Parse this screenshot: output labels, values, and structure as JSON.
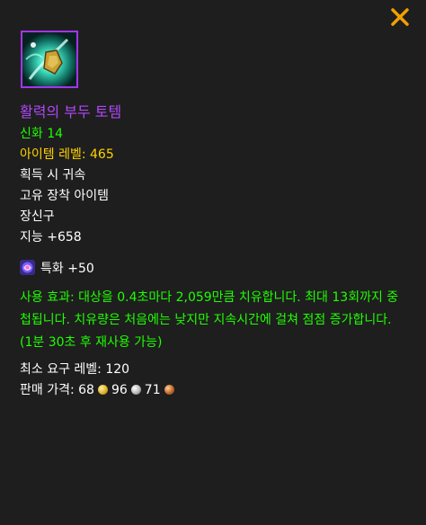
{
  "tooltip": {
    "close_icon": "close-x-icon",
    "item_icon": "totem-icon",
    "name": "활력의 부두 토템",
    "difficulty": "신화 14",
    "item_level": "아이템 레벨: 465",
    "binding": "획득 시 귀속",
    "unique": "고유 장착 아이템",
    "slot": "장신구",
    "primary_stat": "지능 +658",
    "secondary_stat_icon": "mastery-icon",
    "secondary_stat": "특화 +50",
    "use_effect": "사용 효과: 대상을 0.4초마다 2,059만큼 치유합니다. 최대 13회까지 중첩됩니다. 치유량은 처음에는 낮지만 지속시간에 걸쳐 점점 증가합니다. (1분 30초 후 재사용 가능)",
    "required_level": "최소 요구 레벨: 120",
    "sell_price_label": "판매 가격: ",
    "sell_price": {
      "gold": "68",
      "silver": "96",
      "copper": "71"
    },
    "colors": {
      "epic": "#b048f8",
      "uncommon": "#1eff00",
      "item_level": "#ffd100",
      "close": "#f0a000"
    }
  }
}
